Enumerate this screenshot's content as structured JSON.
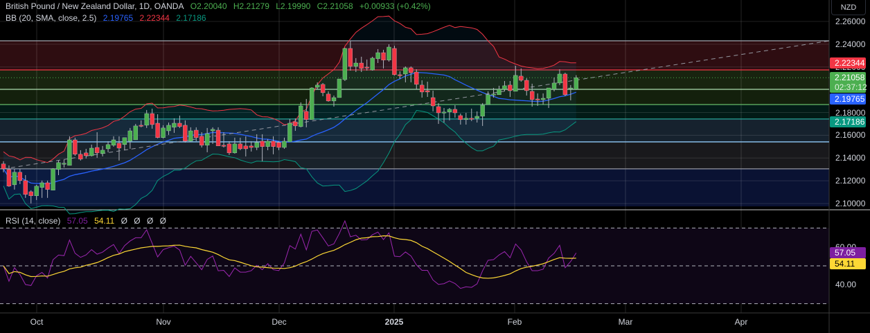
{
  "header": {
    "symbol": "British Pound / New Zealand Dollar, 1D, OANDA",
    "open": "O2.20040",
    "high": "H2.21279",
    "low": "L2.19990",
    "close": "C2.21058",
    "change": "+0.00933 (+0.42%)"
  },
  "bb_legend": {
    "label": "BB (20, SMA, close, 2.5)",
    "basis": "2.19765",
    "upper": "2.22344",
    "lower": "2.17186"
  },
  "rsi_legend": {
    "label": "RSI (14, close)",
    "rsi": "57.05",
    "ma": "54.11",
    "extras": [
      "Ø",
      "Ø",
      "Ø",
      "Ø"
    ]
  },
  "currency_button": "NZD",
  "price_axis": [
    "2.26000",
    "2.24000",
    "2.22000",
    "2.20000",
    "2.18000",
    "2.16000",
    "2.14000",
    "2.12000",
    "2.10000"
  ],
  "rsi_axis": [
    "60.00",
    "40.00"
  ],
  "badges": {
    "upper": {
      "value": "2.22344",
      "color": "#f23645"
    },
    "close": {
      "value": "2.21058",
      "countdown": "02:37:12",
      "color": "#4caf50"
    },
    "basis": {
      "value": "2.19765",
      "color": "#2962ff"
    },
    "lower": {
      "value": "2.17186",
      "color": "#089981"
    },
    "rsi": {
      "value": "57.05",
      "color": "#7e1fa0"
    },
    "rsi_ma": {
      "value": "54.11",
      "color": "#fdd835"
    }
  },
  "time_axis": [
    "Oct",
    "Nov",
    "Dec",
    "2025",
    "Feb",
    "Mar",
    "Apr"
  ],
  "chart_data": {
    "type": "candlestick",
    "title": "British Pound / New Zealand Dollar, 1D, OANDA",
    "ylim": [
      2.0975,
      2.2606
    ],
    "candle_format": "OHLC",
    "candles": [
      [
        2.1348,
        2.1372,
        2.1275,
        2.1305
      ],
      [
        2.1299,
        2.1335,
        2.1147,
        2.1153
      ],
      [
        2.1165,
        2.1305,
        2.1123,
        2.1275
      ],
      [
        2.1275,
        2.1305,
        2.1171,
        2.1202
      ],
      [
        2.1202,
        2.125,
        2.105,
        2.108
      ],
      [
        2.1104,
        2.1117,
        2.1001,
        2.1068
      ],
      [
        2.1068,
        2.1165,
        2.1031,
        2.1153
      ],
      [
        2.1141,
        2.1202,
        2.105,
        2.1183
      ],
      [
        2.1183,
        2.1202,
        2.105,
        2.1123
      ],
      [
        2.1117,
        2.1311,
        2.1117,
        2.1305
      ],
      [
        2.1299,
        2.1378,
        2.125,
        2.136
      ],
      [
        2.1348,
        2.1384,
        2.1317,
        2.1354
      ],
      [
        2.1335,
        2.1591,
        2.1335,
        2.156
      ],
      [
        2.156,
        2.1579,
        2.142,
        2.1433
      ],
      [
        2.1433,
        2.1469,
        2.1378,
        2.139
      ],
      [
        2.1445,
        2.1481,
        2.1396,
        2.142
      ],
      [
        2.142,
        2.1518,
        2.1414,
        2.1487
      ],
      [
        2.1493,
        2.1627,
        2.1402,
        2.1445
      ],
      [
        2.1439,
        2.1506,
        2.1414,
        2.1469
      ],
      [
        2.1481,
        2.1548,
        2.1451,
        2.1518
      ],
      [
        2.1512,
        2.1591,
        2.15,
        2.156
      ],
      [
        2.153,
        2.1591,
        2.1378,
        2.1487
      ],
      [
        2.1518,
        2.1579,
        2.1469,
        2.1579
      ],
      [
        2.1548,
        2.1664,
        2.1481,
        2.1639
      ],
      [
        2.156,
        2.17,
        2.156,
        2.1682
      ],
      [
        2.1688,
        2.1731,
        2.167,
        2.1682
      ],
      [
        2.1688,
        2.1822,
        2.1664,
        2.1791
      ],
      [
        2.1791,
        2.1834,
        2.1658,
        2.1694
      ],
      [
        2.1706,
        2.1785,
        2.1573,
        2.1579
      ],
      [
        2.1579,
        2.1688,
        2.1573,
        2.1664
      ],
      [
        2.1639,
        2.1712,
        2.1603,
        2.1688
      ],
      [
        2.167,
        2.1749,
        2.1621,
        2.1706
      ],
      [
        2.1706,
        2.1773,
        2.1664,
        2.1676
      ],
      [
        2.1688,
        2.1731,
        2.1536,
        2.1548
      ],
      [
        2.1548,
        2.167,
        2.1542,
        2.1639
      ],
      [
        2.1645,
        2.167,
        2.1548,
        2.1579
      ],
      [
        2.1591,
        2.1627,
        2.1493,
        2.1512
      ],
      [
        2.1512,
        2.1664,
        2.1451,
        2.1615
      ],
      [
        2.1639,
        2.167,
        2.1524,
        2.1652
      ],
      [
        2.1645,
        2.167,
        2.1506,
        2.1506
      ],
      [
        2.1512,
        2.1627,
        2.1493,
        2.151
      ],
      [
        2.1524,
        2.1548,
        2.1427,
        2.1445
      ],
      [
        2.1445,
        2.1579,
        2.1439,
        2.1524
      ],
      [
        2.1524,
        2.1579,
        2.1469,
        2.1481
      ],
      [
        2.1506,
        2.1591,
        2.1414,
        2.1481
      ],
      [
        2.1506,
        2.1548,
        2.1457,
        2.1493
      ],
      [
        2.1493,
        2.1609,
        2.1469,
        2.1536
      ],
      [
        2.1548,
        2.1609,
        2.1372,
        2.15
      ],
      [
        2.15,
        2.1566,
        2.1469,
        2.1548
      ],
      [
        2.1548,
        2.1591,
        2.1433,
        2.15
      ],
      [
        2.1536,
        2.1548,
        2.1469,
        2.1493
      ],
      [
        2.1493,
        2.1579,
        2.1481,
        2.1548
      ],
      [
        2.1542,
        2.1743,
        2.1542,
        2.1706
      ],
      [
        2.1718,
        2.1749,
        2.1639,
        2.1682
      ],
      [
        2.1676,
        2.1889,
        2.167,
        2.1858
      ],
      [
        2.181,
        2.1919,
        2.167,
        2.1737
      ],
      [
        2.1737,
        2.2022,
        2.1737,
        2.2016
      ],
      [
        2.2022,
        2.2065,
        2.2004,
        2.2041
      ],
      [
        2.2047,
        2.2059,
        2.1943,
        2.1974
      ],
      [
        2.1962,
        2.1986,
        2.1895,
        2.1901
      ],
      [
        2.1901,
        2.1949,
        2.1852,
        2.1931
      ],
      [
        2.1931,
        2.2095,
        2.1931,
        2.2095
      ],
      [
        2.2089,
        2.2369,
        2.2077,
        2.2363
      ],
      [
        2.2363,
        2.243,
        2.2168,
        2.2205
      ],
      [
        2.2205,
        2.2278,
        2.2156,
        2.2235
      ],
      [
        2.2235,
        2.229,
        2.2156,
        2.2187
      ],
      [
        2.2199,
        2.2266,
        2.2168,
        2.2193
      ],
      [
        2.2174,
        2.229,
        2.2168,
        2.2278
      ],
      [
        2.2272,
        2.2357,
        2.2235,
        2.2326
      ],
      [
        2.2326,
        2.2351,
        2.2187,
        2.226
      ],
      [
        2.226,
        2.2399,
        2.2247,
        2.2375
      ],
      [
        2.2363,
        2.2387,
        2.2126,
        2.2132
      ],
      [
        2.2132,
        2.2162,
        2.2095,
        2.2126
      ],
      [
        2.2138,
        2.2205,
        2.2065,
        2.2193
      ],
      [
        2.2193,
        2.2205,
        2.2065,
        2.215
      ],
      [
        2.2156,
        2.218,
        2.2004,
        2.2047
      ],
      [
        2.2041,
        2.2083,
        2.1931,
        2.198
      ],
      [
        2.1992,
        2.2071,
        2.1937,
        2.198
      ],
      [
        2.1931,
        2.1992,
        2.181,
        2.1858
      ],
      [
        2.1852,
        2.1883,
        2.17,
        2.1797
      ],
      [
        2.18,
        2.184,
        2.1712,
        2.1804
      ],
      [
        2.1804,
        2.184,
        2.1731,
        2.1828
      ],
      [
        2.1828,
        2.1864,
        2.1755,
        2.1797
      ],
      [
        2.1773,
        2.1791,
        2.1694,
        2.1737
      ],
      [
        2.1737,
        2.1797,
        2.1694,
        2.1749
      ],
      [
        2.1749,
        2.1834,
        2.1725,
        2.1743
      ],
      [
        2.1749,
        2.181,
        2.1712,
        2.1767
      ],
      [
        2.1767,
        2.1883,
        2.1682,
        2.1864
      ],
      [
        2.187,
        2.1986,
        2.187,
        2.1956
      ],
      [
        2.1956,
        2.2016,
        2.1931,
        2.1962
      ],
      [
        2.1956,
        2.2035,
        2.1956,
        2.2004
      ],
      [
        2.2004,
        2.2077,
        2.1986,
        2.2035
      ],
      [
        2.2041,
        2.2077,
        2.1937,
        2.1992
      ],
      [
        2.1986,
        2.2211,
        2.1986,
        2.2126
      ],
      [
        2.212,
        2.2187,
        2.2071,
        2.2083
      ],
      [
        2.2083,
        2.2101,
        2.1949,
        2.1992
      ],
      [
        2.1986,
        2.2053,
        2.1852,
        2.1913
      ],
      [
        2.1919,
        2.1968,
        2.1858,
        2.1913
      ],
      [
        2.1913,
        2.1968,
        2.187,
        2.1925
      ],
      [
        2.1925,
        2.2016,
        2.184,
        2.2016
      ],
      [
        2.2004,
        2.2107,
        2.1986,
        2.2059
      ],
      [
        2.2059,
        2.218,
        2.2041,
        2.2138
      ],
      [
        2.2138,
        2.215,
        2.1943,
        2.1956
      ],
      [
        2.201,
        2.2041,
        2.1907,
        2.2016
      ],
      [
        2.2004,
        2.21279,
        2.1999,
        2.21058
      ]
    ],
    "bollinger": {
      "period": 20,
      "mult": 2.5,
      "basis_color": "#2962ff",
      "upper_color": "#f23645",
      "lower_color": "#089981"
    },
    "rsi": {
      "period": 14,
      "ma_period": 14,
      "line_color": "#9c27b0",
      "ma_color": "#fdd835",
      "levels": [
        70,
        50,
        30
      ],
      "ylim": [
        25,
        75
      ]
    },
    "horizontal_levels": [
      {
        "price": 2.243,
        "color": "#9598a1"
      },
      {
        "price": 2.2174,
        "color": "#f23645"
      },
      {
        "price": 2.2004,
        "color": "#a5d6a7"
      },
      {
        "price": 2.187,
        "color": "#66bb6a"
      },
      {
        "price": 2.1743,
        "color": "#26a69a"
      },
      {
        "price": 2.1542,
        "color": "#90caf9"
      },
      {
        "price": 2.1305,
        "color": "#9598a1"
      }
    ],
    "zones": [
      {
        "from": 2.243,
        "to": 2.2174,
        "color": "#2e0d11"
      },
      {
        "from": 2.2174,
        "to": 2.2004,
        "color": "#18240f"
      },
      {
        "from": 2.2004,
        "to": 2.187,
        "color": "#13200c"
      },
      {
        "from": 2.187,
        "to": 2.1743,
        "color": "#021b17"
      },
      {
        "from": 2.1743,
        "to": 2.1542,
        "color": "#16222e"
      },
      {
        "from": 2.1542,
        "to": 2.1305,
        "color": "#19191c"
      },
      {
        "from": 2.1305,
        "to": 2.0975,
        "color": "#0a1233"
      }
    ],
    "trendline": {
      "start_bar": 0,
      "start_price": 2.1305,
      "end_bar": 150,
      "end_price": 2.243
    },
    "up_color": "#4caf50",
    "down_color": "#f23645"
  }
}
